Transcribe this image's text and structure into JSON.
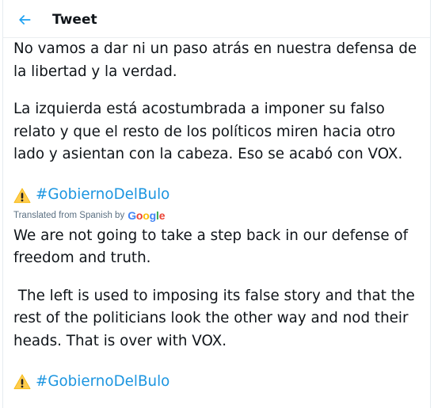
{
  "header": {
    "back_icon": "arrow-left-icon",
    "title": "Tweet",
    "accent": "#1da1f2"
  },
  "tweet": {
    "original": {
      "paragraph1": [
        "No vamos a dar ni un paso atrás en nuestra defensa de",
        "la libertad y la verdad."
      ],
      "paragraph2": [
        "La izquierda está acostumbrada a imponer su falso",
        "relato y que el resto de los políticos miren hacia otro",
        "lado y asientan con la cabeza. Eso se acabó con VOX."
      ],
      "hashtag": "#GobiernoDelBulo"
    },
    "translation_note": {
      "label": "Translated from Spanish by",
      "provider": "Google"
    },
    "translated": {
      "paragraph1": [
        "We are not going to take a step back in our defense of",
        "freedom and truth."
      ],
      "paragraph2": [
        " The left is used to imposing its false story and that the",
        "rest of the politicians look the other way and nod their",
        "heads. That is over with VOX."
      ],
      "hashtag": "#GobiernoDelBulo"
    },
    "warning_icon": "warning-icon",
    "hashtag_color": "#1b95e0"
  }
}
